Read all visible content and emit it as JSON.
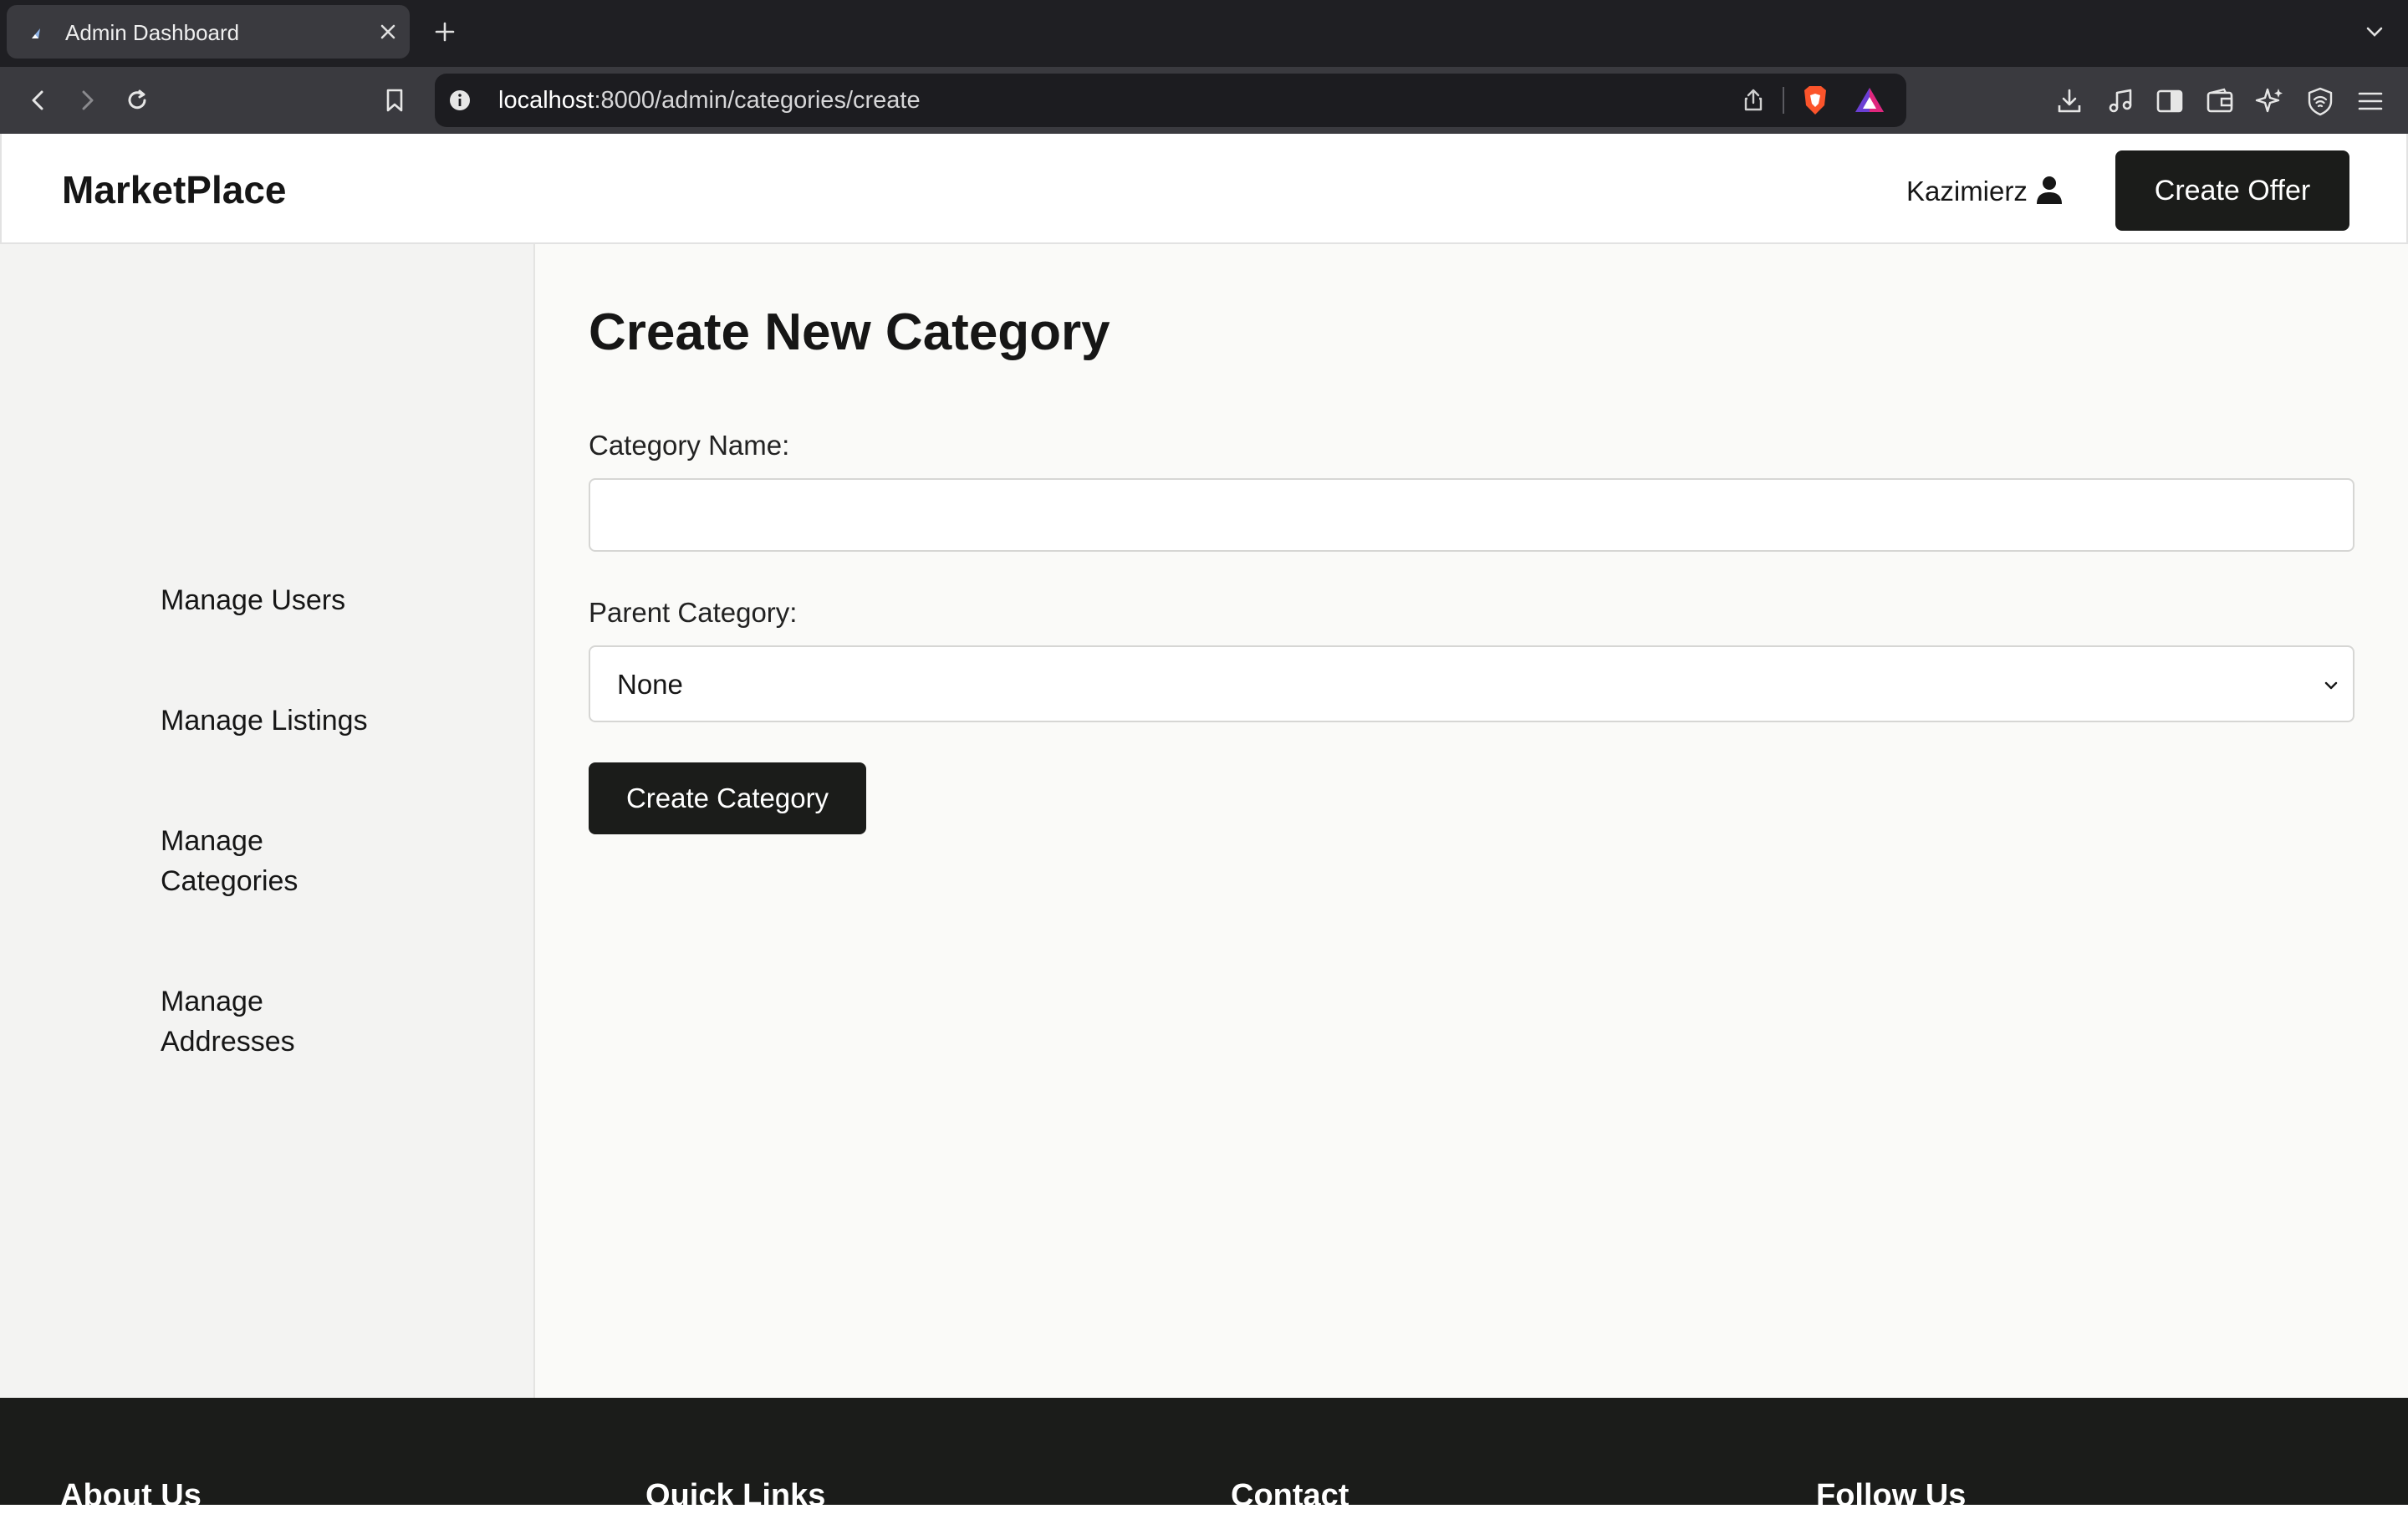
{
  "browser": {
    "tab_title": "Admin Dashboard",
    "url_host": "localhost",
    "url_rest": ":8000/admin/categories/create"
  },
  "header": {
    "brand": "MarketPlace",
    "user_name": "Kazimierz",
    "create_offer_label": "Create Offer"
  },
  "sidebar": {
    "items": [
      {
        "label": "Manage Users"
      },
      {
        "label": "Manage Listings"
      },
      {
        "label": "Manage Categories"
      },
      {
        "label": "Manage Addresses"
      }
    ]
  },
  "form": {
    "title": "Create New Category",
    "name_label": "Category Name:",
    "name_value": "",
    "parent_label": "Parent Category:",
    "parent_selected": "None",
    "submit_label": "Create Category"
  },
  "footer": {
    "headings": [
      "About Us",
      "Quick Links",
      "Contact",
      "Follow Us"
    ]
  },
  "colors": {
    "browser_bg": "#1f1f23",
    "toolbar_bg": "#3a3a3f",
    "primary_button": "#1b1c1a",
    "sidebar_bg": "#f3f3f2",
    "main_bg": "#fafaf8",
    "footer_bg": "#1b1c1a"
  }
}
